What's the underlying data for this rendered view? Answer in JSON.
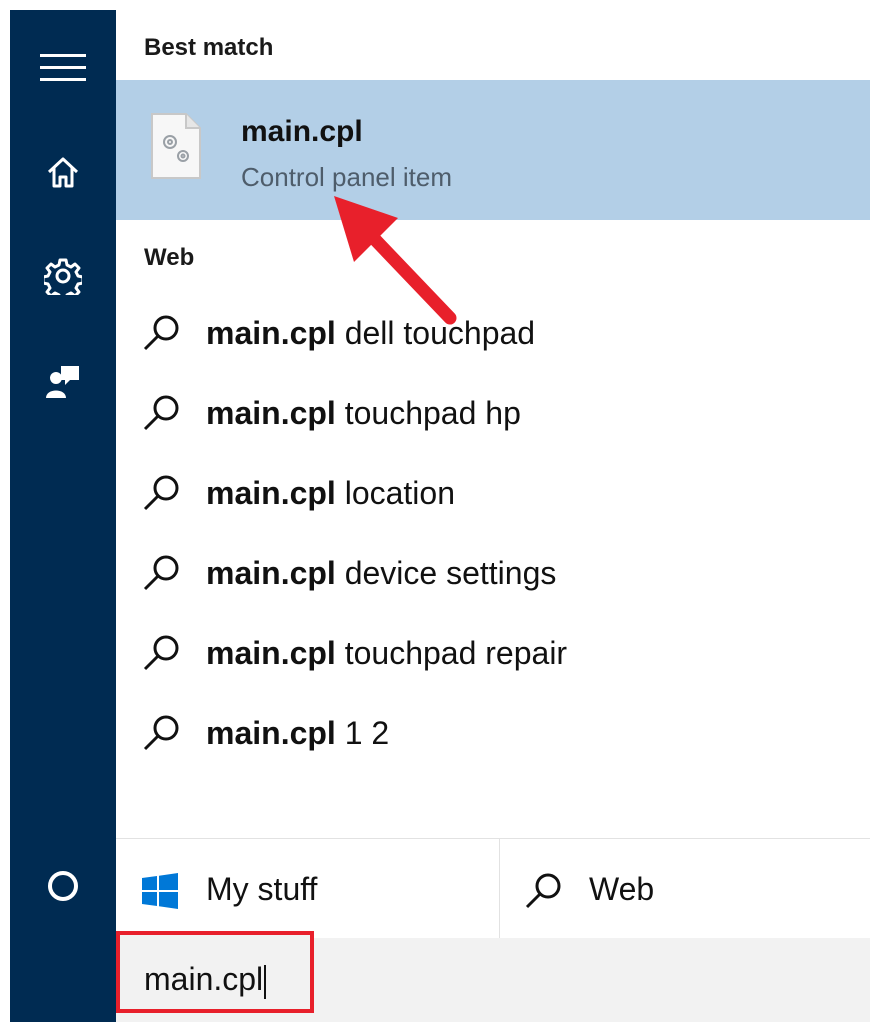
{
  "rail": {
    "icons": [
      "hamburger-menu-icon",
      "home-icon",
      "gear-icon",
      "feedback-icon",
      "cortana-circle-icon"
    ]
  },
  "best_match": {
    "header": "Best match",
    "title": "main.cpl",
    "subtitle": "Control panel item",
    "icon": "control-panel-file-icon"
  },
  "web": {
    "header": "Web",
    "items": [
      {
        "bold": "main.cpl",
        "rest": " dell touchpad"
      },
      {
        "bold": "main.cpl",
        "rest": " touchpad hp"
      },
      {
        "bold": "main.cpl",
        "rest": " location"
      },
      {
        "bold": "main.cpl",
        "rest": " device settings"
      },
      {
        "bold": "main.cpl",
        "rest": " touchpad repair"
      },
      {
        "bold": "main.cpl",
        "rest": " 1 2"
      }
    ]
  },
  "filters": {
    "my_stuff": "My stuff",
    "web": "Web"
  },
  "search": {
    "value": "main.cpl"
  },
  "colors": {
    "rail": "#002b52",
    "highlight": "#b3cfe7",
    "annotation_red": "#e8202b",
    "windows_blue": "#0078d7"
  }
}
